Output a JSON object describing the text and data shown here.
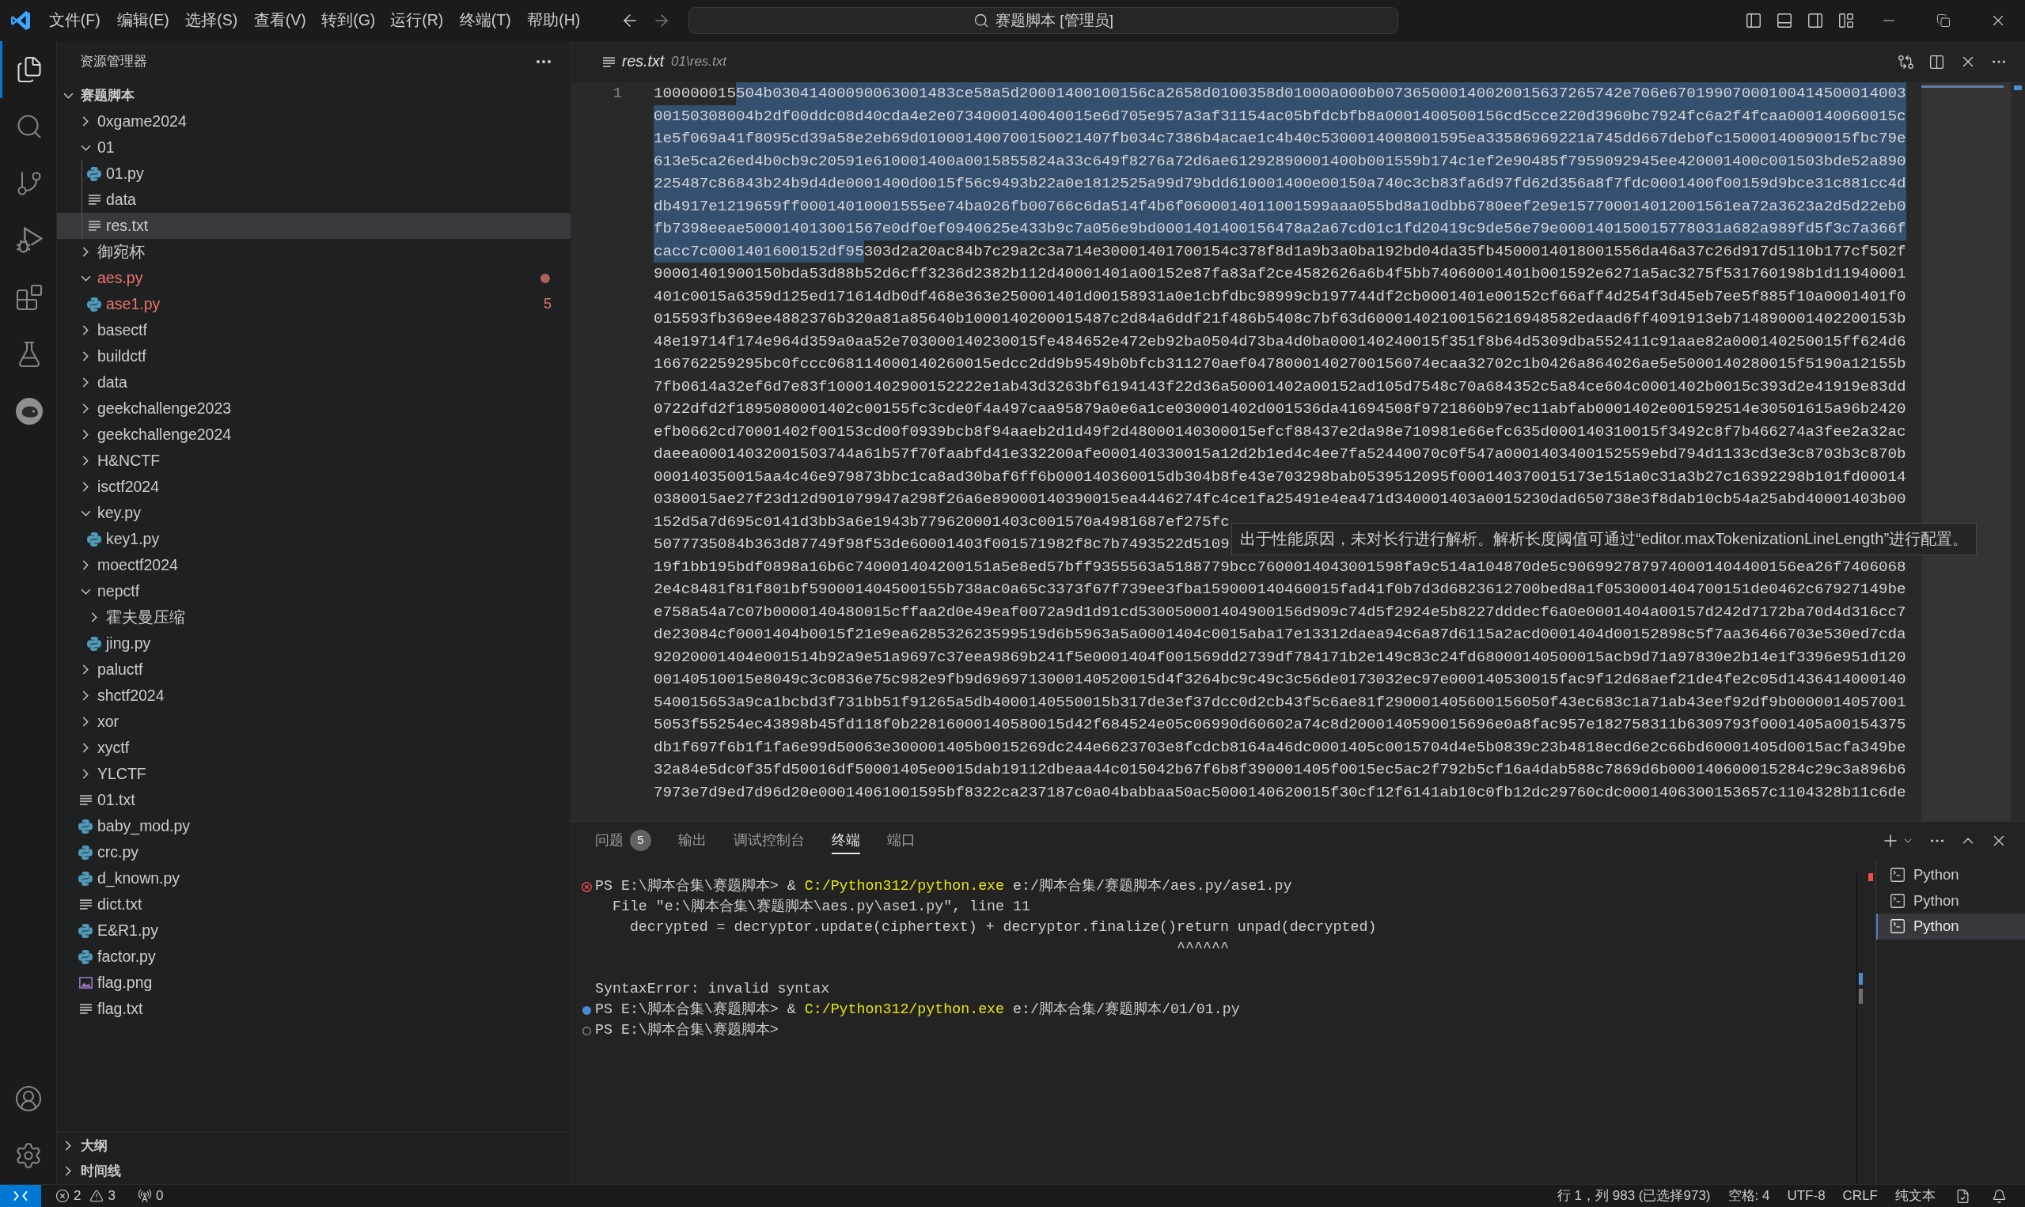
{
  "title_bar": {
    "menus": [
      "文件(F)",
      "编辑(E)",
      "选择(S)",
      "查看(V)",
      "转到(G)",
      "运行(R)",
      "终端(T)",
      "帮助(H)"
    ],
    "command_center": "赛题脚本 [管理员]"
  },
  "activity_bar": [
    {
      "selected": true
    },
    {
      "selected": false
    },
    {
      "selected": false
    },
    {
      "selected": false
    },
    {
      "selected": false
    },
    {
      "selected": false
    },
    {
      "selected": false
    }
  ],
  "sidebar": {
    "title": "资源管理器",
    "root": {
      "name": "赛题脚本",
      "expanded": true
    },
    "tree": [
      {
        "name": "0xgame2024",
        "kind": "folder",
        "expanded": false,
        "selected": false,
        "error": false
      },
      {
        "name": "01",
        "kind": "folder",
        "expanded": true,
        "selected": false,
        "error": false,
        "children": [
          {
            "name": "01.py",
            "kind": "python",
            "selected": false,
            "error": false
          },
          {
            "name": "data",
            "kind": "text",
            "selected": false,
            "error": false
          },
          {
            "name": "res.txt",
            "kind": "text",
            "selected": true,
            "error": false
          }
        ]
      },
      {
        "name": "御宛杯",
        "kind": "folder",
        "expanded": false,
        "selected": false,
        "error": false
      },
      {
        "name": "aes.py",
        "kind": "folder",
        "expanded": true,
        "selected": false,
        "error": true,
        "children": [
          {
            "name": "ase1.py",
            "kind": "python",
            "selected": false,
            "error": true,
            "problems": "5"
          }
        ]
      },
      {
        "name": "basectf",
        "kind": "folder",
        "expanded": false,
        "selected": false,
        "error": false
      },
      {
        "name": "buildctf",
        "kind": "folder",
        "expanded": false,
        "selected": false,
        "error": false
      },
      {
        "name": "data",
        "kind": "folder",
        "expanded": false,
        "selected": false,
        "error": false
      },
      {
        "name": "geekchallenge2023",
        "kind": "folder",
        "expanded": false,
        "selected": false,
        "error": false
      },
      {
        "name": "geekchallenge2024",
        "kind": "folder",
        "expanded": false,
        "selected": false,
        "error": false
      },
      {
        "name": "H&NCTF",
        "kind": "folder",
        "expanded": false,
        "selected": false,
        "error": false
      },
      {
        "name": "isctf2024",
        "kind": "folder",
        "expanded": false,
        "selected": false,
        "error": false
      },
      {
        "name": "key.py",
        "kind": "folder",
        "expanded": true,
        "selected": false,
        "error": false,
        "children": [
          {
            "name": "key1.py",
            "kind": "python",
            "selected": false,
            "error": false
          }
        ]
      },
      {
        "name": "moectf2024",
        "kind": "folder",
        "expanded": false,
        "selected": false,
        "error": false
      },
      {
        "name": "nepctf",
        "kind": "folder",
        "expanded": true,
        "selected": false,
        "error": false,
        "children": [
          {
            "name": "霍夫曼压缩",
            "kind": "folder",
            "expanded": false,
            "selected": false,
            "error": false
          },
          {
            "name": "jing.py",
            "kind": "python",
            "selected": false,
            "error": false
          }
        ]
      },
      {
        "name": "paluctf",
        "kind": "folder",
        "expanded": false,
        "selected": false,
        "error": false
      },
      {
        "name": "shctf2024",
        "kind": "folder",
        "expanded": false,
        "selected": false,
        "error": false
      },
      {
        "name": "xor",
        "kind": "folder",
        "expanded": false,
        "selected": false,
        "error": false
      },
      {
        "name": "xyctf",
        "kind": "folder",
        "expanded": false,
        "selected": false,
        "error": false
      },
      {
        "name": "YLCTF",
        "kind": "folder",
        "expanded": false,
        "selected": false,
        "error": false
      },
      {
        "name": "01.txt",
        "kind": "text",
        "selected": false,
        "error": false
      },
      {
        "name": "baby_mod.py",
        "kind": "python",
        "selected": false,
        "error": false
      },
      {
        "name": "crc.py",
        "kind": "python",
        "selected": false,
        "error": false
      },
      {
        "name": "d_known.py",
        "kind": "python",
        "selected": false,
        "error": false
      },
      {
        "name": "dict.txt",
        "kind": "text",
        "selected": false,
        "error": false
      },
      {
        "name": "E&R1.py",
        "kind": "python",
        "selected": false,
        "error": false
      },
      {
        "name": "factor.py",
        "kind": "python",
        "selected": false,
        "error": false
      },
      {
        "name": "flag.png",
        "kind": "image",
        "selected": false,
        "error": false
      },
      {
        "name": "flag.txt",
        "kind": "text",
        "selected": false,
        "error": false
      }
    ],
    "sections": [
      {
        "label": "大纲",
        "expanded": false
      },
      {
        "label": "时间线",
        "expanded": false
      }
    ]
  },
  "editor": {
    "tab": {
      "label": "res.txt",
      "description": "01\\res.txt",
      "preview": true
    },
    "line_number": "1",
    "rows": [
      {
        "segments": [
          {
            "text": "100000015",
            "selected": false
          },
          {
            "text": "504b03041400090063001483ce58a5d20001400100156ca2658d0100358d01000a000b007365000140020015637265742e706e67019907000100414500014003",
            "selected": true
          }
        ]
      },
      {
        "segments": [
          {
            "text": "00150308004b2df00ddc08d40cda4e2e0734000140040015e6d705e957a3af31154ac05bfdcbfb8a0001400500156cd5cce220d3960bc7924fc6a2f4fcaa000140060015c",
            "selected": true
          }
        ]
      },
      {
        "segments": [
          {
            "text": "1e5f069a41f8095cd39a58e2eb69d010001400700150021407fb034c7386b4acae1c4b40c5300014008001595ea33586969221a745dd667deb0fc15000140090015fbc79e",
            "selected": true
          }
        ]
      },
      {
        "segments": [
          {
            "text": "613e5ca26ed4b0cb9c20591e610001400a0015855824a33c649f8276a72d6ae61292890001400b001559b174c1ef2e90485f7959092945ee420001400c001503bde52a890",
            "selected": true
          }
        ]
      },
      {
        "segments": [
          {
            "text": "225487c86843b24b9d4de0001400d0015f56c9493b22a0e1812525a99d79bdd610001400e00150a740c3cb83fa6d97fd62d356a8f7fdc0001400f00159d9bce31c881cc4d",
            "selected": true
          }
        ]
      },
      {
        "segments": [
          {
            "text": "db4917e1219659ff00014010001555ee74ba026fb00766c6da514f4b6f0600014011001599aaa055bd8a10dbb6780eef2e9e157700014012001561ea72a3623a2d5d22eb0",
            "selected": true
          }
        ]
      },
      {
        "segments": [
          {
            "text": "fb7398eeae500014013001567e0df0ef0940625e433b9c7a056e9bd0001401400156478a2a67cd01c1fd20419c9de56e79e000140150015778031a682a989fd5f3c7a366f",
            "selected": true
          }
        ]
      },
      {
        "segments": [
          {
            "text": "cacc7c0001401600152df95",
            "selected": true
          },
          {
            "text": "303d2a20ac84b7c29a2c3a714e30001401700154c378f8d1a9b3a0ba192bd04da35fb4500014018001556da46a37c26d917d5110b177cf502f",
            "selected": false
          }
        ]
      },
      {
        "segments": [
          {
            "text": "90001401900150bda53d88b52d6cff3236d2382b112d40001401a00152e87fa83af2ce4582626a6b4f5bb74060001401b001592e6271a5ac3275f531760198b1d11940001",
            "selected": false
          }
        ]
      },
      {
        "segments": [
          {
            "text": "401c0015a6359d125ed171614db0df468e363e250001401d00158931a0e1cbfdbc98999cb197744df2cb0001401e00152cf66aff4d254f3d45eb7ee5f885f10a0001401f0",
            "selected": false
          }
        ]
      },
      {
        "segments": [
          {
            "text": "015593fb369ee4882376b320a81a85640b1000140200015487c2d84a6ddf21f486b5408c7bf63d60001402100156216948582edaad6ff4091913eb714890001402200153b",
            "selected": false
          }
        ]
      },
      {
        "segments": [
          {
            "text": "48e19714f174e964d359a0aa52e703000140230015fe484652e472eb92ba0504d73ba4d0ba000140240015f351f8b64d5309dba552411c91aae82a000140250015ff624d6",
            "selected": false
          }
        ]
      },
      {
        "segments": [
          {
            "text": "166762259295bc0fccc068114000140260015edcc2dd9b9549b0bfcb311270aef04780001402700156074ecaa32702c1b0426a864026ae5e5000140280015f5190a12155b",
            "selected": false
          }
        ]
      },
      {
        "segments": [
          {
            "text": "7fb0614a32ef6d7e83f10001402900152222e1ab43d3263bf6194143f22d36a50001402a00152ad105d7548c70a684352c5a84ce604c0001402b0015c393d2e41919e83dd",
            "selected": false
          }
        ]
      },
      {
        "segments": [
          {
            "text": "0722dfd2f1895080001402c00155fc3cde0f4a497caa95879a0e6a1ce030001402d001536da41694508f9721860b97ec11abfab0001402e001592514e30501615a96b2420",
            "selected": false
          }
        ]
      },
      {
        "segments": [
          {
            "text": "efb0662cd70001402f00153cd00f0939bcb8f94aaeb2d1d49f2d48000140300015efcf88437e2da98e710981e66efc635d000140310015f3492c8f7b466274a3fee2a32ac",
            "selected": false
          }
        ]
      },
      {
        "segments": [
          {
            "text": "daeea00014032001503744a61b57f70faabfd41e332200afe000140330015a12d2b1ed4c4ee7fa52440070c0f547a0001403400152559ebd794d1133cd3e3c8703b3c870b",
            "selected": false
          }
        ]
      },
      {
        "segments": [
          {
            "text": "000140350015aa4c46e979873bbc1ca8ad30baf6ff6b000140360015db304b8fe43e703298bab0539512095f000140370015173e151a0c31a3b27c16392298b101fd00014",
            "selected": false
          }
        ]
      },
      {
        "segments": [
          {
            "text": "0380015ae27f23d12d901079947a298f26a6e89000140390015ea4446274fc4ce1fa25491e4ea471d340001403a0015230dad650738e3f8dab10cb54a25abd40001403b00",
            "selected": false
          }
        ]
      },
      {
        "segments": [
          {
            "text": "152d5a7d695c0141d3bb3a6e1943b779620001403c001570a4981687ef275fc",
            "selected": false
          }
        ]
      },
      {
        "segments": [
          {
            "text": "5077735084b363d87749f98f53de60001403f001571982f8c7b7493522d5109",
            "selected": false
          }
        ]
      },
      {
        "segments": [
          {
            "text": "19f1bb195bdf0898a16b6c740001404200151a5e8ed57bff9355563a5188779bcc7600014043001598fa9c514a104870de5c9069927879740001404400156ea26f7406068",
            "selected": false
          }
        ]
      },
      {
        "segments": [
          {
            "text": "2e4c8481f81f801bf590001404500155b738ac0a65c3373f67f739ee3fba159000140460015fad41f0b7d3d6823612700bed8a1f0530001404700151de0462c67927149be",
            "selected": false
          }
        ]
      },
      {
        "segments": [
          {
            "text": "e758a54a7c07b0000140480015cffaa2d0e49eaf0072a9d1d91cd530050001404900156d909c74d5f2924e5b8227dddecf6a0e0001404a00157d242d7172ba70d4d316cc7",
            "selected": false
          }
        ]
      },
      {
        "segments": [
          {
            "text": "de23084cf0001404b0015f21e9ea628532623599519d6b5963a5a0001404c0015aba17e13312daea94c6a87d6115a2acd0001404d00152898c5f7aa36466703e530ed7cda",
            "selected": false
          }
        ]
      },
      {
        "segments": [
          {
            "text": "92020001404e001514b92a9e51a9697c37eea9869b241f5e0001404f001569dd2739df784171b2e149c83c24fd68000140500015acb9d71a97830e2b14e1f3396e951d120",
            "selected": false
          }
        ]
      },
      {
        "segments": [
          {
            "text": "00140510015e8049c3c0836e75c982e9fb9d6969713000140520015d4f3264bc9c49c3c56de0173032ec97e000140530015fac9f12d68aef21de4fe2c05d1436414000140",
            "selected": false
          }
        ]
      },
      {
        "segments": [
          {
            "text": "540015653a9ca1bcbd3f731bb51f91265a5db4000140550015b317de3ef37dcc0d2cb43f5c6ae81f290001405600156050f43ec683c1a71ab43eef92df9b0000014057001",
            "selected": false
          }
        ]
      },
      {
        "segments": [
          {
            "text": "5053f55254ec43898b45fd118f0b22816000140580015d42f684524e05c06990d60602a74c8d2000140590015696e0a8fac957e182758311b6309793f0001405a00154375",
            "selected": false
          }
        ]
      },
      {
        "segments": [
          {
            "text": "db1f697f6b1f1fa6e99d50063e300001405b0015269dc244e6623703e8fcdcb8164a46dc0001405c0015704d4e5b0839c23b4818ecd6e2c66bd60001405d0015acfa349be",
            "selected": false
          }
        ]
      },
      {
        "segments": [
          {
            "text": "32a84e5dc0f35fd50016df50001405e0015dab19112dbeaa44c015042b67f6b8f390001405f0015ec5ac2f792b5cf16a4dab588c7869d6b000140600015284c29c3a896b6",
            "selected": false
          }
        ]
      },
      {
        "segments": [
          {
            "text": "7973e7d9ed7d96d20e00014061001595bf8322ca237187c0a04babbaa50ac5000140620015f30cf12f6141ab10c0fb12dc29760cdc0001406300153657c1104328b11c6de",
            "selected": false
          }
        ]
      }
    ],
    "hover": "出于性能原因，未对长行进行解析。解析长度阈值可通过“editor.maxTokenizationLineLength”进行配置。"
  },
  "panel": {
    "tabs": [
      {
        "label": "问题",
        "badge": "5",
        "selected": false
      },
      {
        "label": "输出",
        "selected": false
      },
      {
        "label": "调试控制台",
        "selected": false
      },
      {
        "label": "终端",
        "selected": true
      },
      {
        "label": "端口",
        "selected": false
      }
    ],
    "terminal": {
      "lines": [
        {
          "kind": "command",
          "done": true,
          "failed": true,
          "prompt": "PS E:\\脚本合集\\赛题脚本>",
          "operator": "&",
          "executable": "C:/Python312/python.exe",
          "arguments": "e:/脚本合集/赛题脚本/aes.py/ase1.py"
        },
        {
          "kind": "output",
          "text": "  File \"e:\\脚本合集\\赛题脚本\\aes.py\\ase1.py\", line 11"
        },
        {
          "kind": "output",
          "text": "    decrypted = decryptor.update(ciphertext) + decryptor.finalize()return unpad(decrypted)"
        },
        {
          "kind": "output",
          "text": "                                                                   ^^^^^^"
        },
        {
          "kind": "blank"
        },
        {
          "kind": "output",
          "text": "SyntaxError: invalid syntax"
        },
        {
          "kind": "command",
          "done": true,
          "failed": false,
          "prompt": "PS E:\\脚本合集\\赛题脚本>",
          "operator": "&",
          "executable": "C:/Python312/python.exe",
          "arguments": "e:/脚本合集/赛题脚本/01/01.py"
        },
        {
          "kind": "prompt",
          "done": false,
          "prompt": "PS E:\\脚本合集\\赛题脚本>"
        }
      ]
    },
    "sessions": [
      {
        "label": "Python",
        "selected": false
      },
      {
        "label": "Python",
        "selected": false
      },
      {
        "label": "Python",
        "selected": true
      }
    ]
  },
  "status_bar": {
    "problems": {
      "errors": "2",
      "warnings": "3"
    },
    "ports": "0",
    "items": [
      "行 1，列 983 (已选择973)",
      "空格: 4",
      "UTF-8",
      "CRLF",
      "纯文本"
    ]
  }
}
